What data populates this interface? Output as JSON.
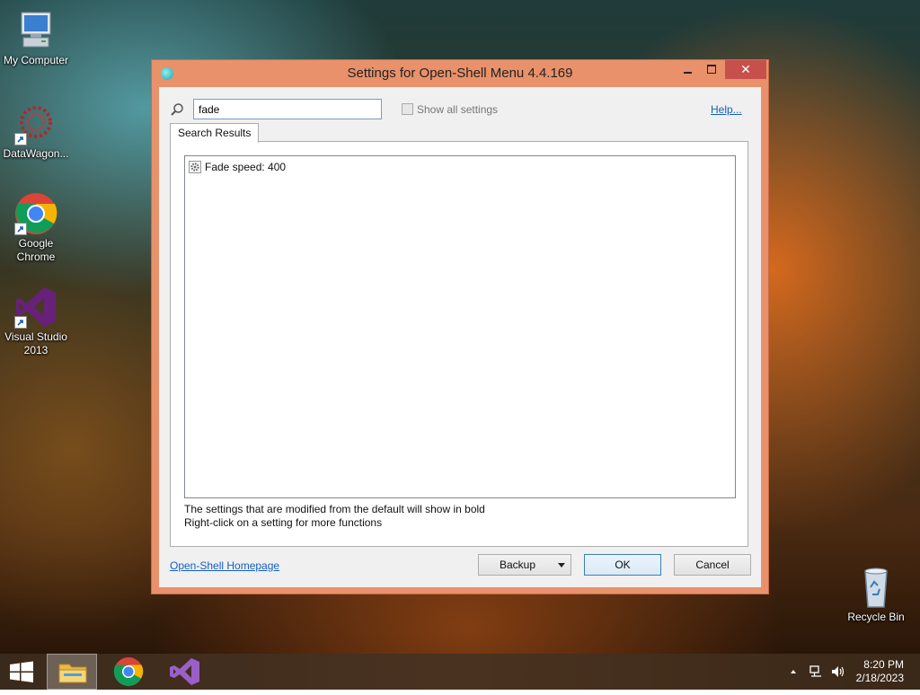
{
  "desktop": {
    "icons": [
      {
        "label": "My Computer"
      },
      {
        "label": "DataWagon..."
      },
      {
        "label": "Google Chrome"
      },
      {
        "label": "Visual Studio 2013"
      },
      {
        "label": "Recycle Bin"
      }
    ]
  },
  "dialog": {
    "title": "Settings for Open-Shell Menu 4.4.169",
    "close_label": "✕",
    "search": {
      "value": "fade",
      "placeholder": ""
    },
    "show_all_label": "Show all settings",
    "help_label": "Help...",
    "tab_label": "Search Results",
    "results": [
      {
        "label": "Fade speed: 400",
        "icon": "gear-icon"
      }
    ],
    "hint_line1": "The settings that are modified from the default will show in bold",
    "hint_line2": "Right-click on a setting for more functions",
    "homepage_label": "Open-Shell Homepage",
    "backup_label": "Backup",
    "ok_label": "OK",
    "cancel_label": "Cancel"
  },
  "taskbar": {
    "time": "8:20 PM",
    "date": "2/18/2023"
  },
  "colors": {
    "accent": "#e9916a",
    "close_red": "#c7504c",
    "link_blue": "#1560c0"
  }
}
